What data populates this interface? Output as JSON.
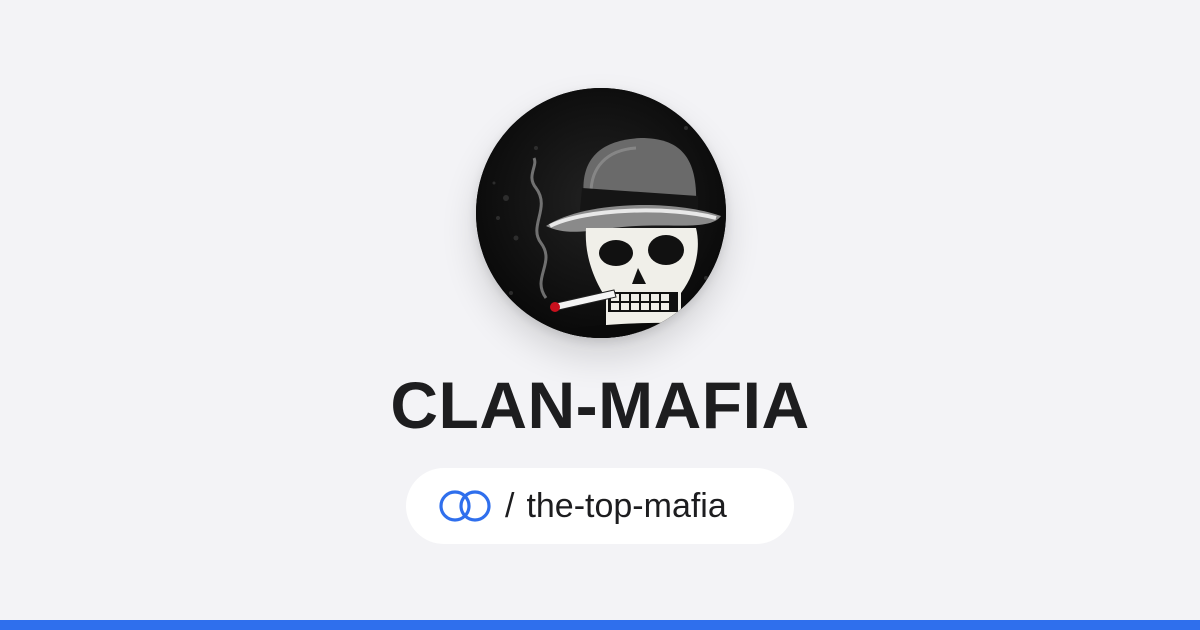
{
  "profile": {
    "name": "CLAN-MAFIA",
    "slash": "/",
    "handle": "the-top-mafia",
    "avatar_alt": "skull-with-fedora-avatar"
  },
  "brand": {
    "logo_icon": "linked-rings-icon",
    "accent_color": "#2f6fed",
    "background_color": "#f3f3f6"
  }
}
